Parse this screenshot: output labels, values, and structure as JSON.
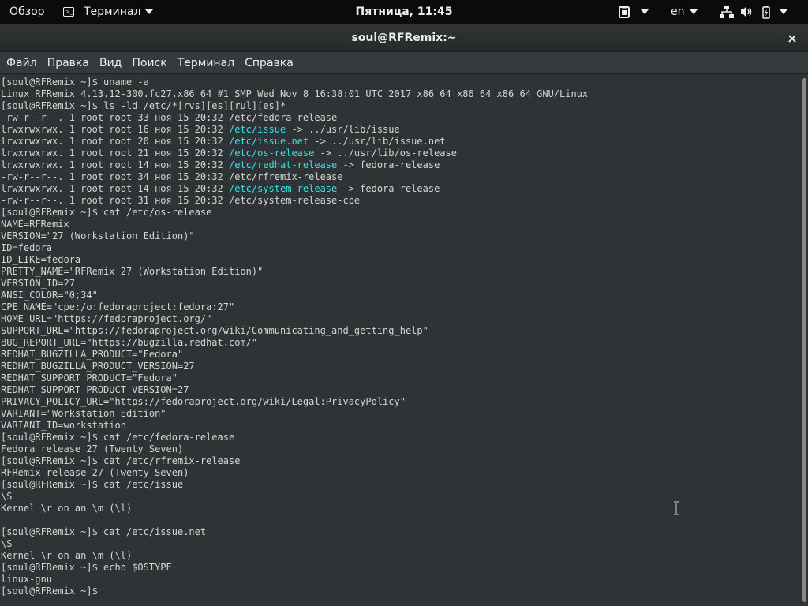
{
  "topbar": {
    "activities": "Обзор",
    "app_menu": "Терминал",
    "clock": "Пятница, 11:45",
    "language": "en",
    "icons": [
      "clipboard-icon",
      "network-icon",
      "volume-icon",
      "battery-icon"
    ]
  },
  "window": {
    "title": "soul@RFRemix:~",
    "close": "×"
  },
  "menubar": [
    "Файл",
    "Правка",
    "Вид",
    "Поиск",
    "Терминал",
    "Справка"
  ],
  "colors": {
    "terminal_bg": "#2e3436",
    "terminal_fg": "#d3d7cf",
    "symlink": "#34e2e2"
  },
  "terminal": {
    "lines": [
      [
        {
          "t": "[soul@RFRemix ~]$ uname -a"
        }
      ],
      [
        {
          "t": "Linux RFRemix 4.13.12-300.fc27.x86_64 #1 SMP Wed Nov 8 16:38:01 UTC 2017 x86_64 x86_64 x86_64 GNU/Linux"
        }
      ],
      [
        {
          "t": "[soul@RFRemix ~]$ ls -ld /etc/*[rvs][es][rul][es]*"
        }
      ],
      [
        {
          "t": "-rw-r--r--. 1 root root 33 ноя 15 20:32 /etc/fedora-release"
        }
      ],
      [
        {
          "t": "lrwxrwxrwx. 1 root root 16 ноя 15 20:32 "
        },
        {
          "t": "/etc/issue",
          "c": "cyan"
        },
        {
          "t": " -> ../usr/lib/issue"
        }
      ],
      [
        {
          "t": "lrwxrwxrwx. 1 root root 20 ноя 15 20:32 "
        },
        {
          "t": "/etc/issue.net",
          "c": "cyan"
        },
        {
          "t": " -> ../usr/lib/issue.net"
        }
      ],
      [
        {
          "t": "lrwxrwxrwx. 1 root root 21 ноя 15 20:32 "
        },
        {
          "t": "/etc/os-release",
          "c": "cyan"
        },
        {
          "t": " -> ../usr/lib/os-release"
        }
      ],
      [
        {
          "t": "lrwxrwxrwx. 1 root root 14 ноя 15 20:32 "
        },
        {
          "t": "/etc/redhat-release",
          "c": "cyan"
        },
        {
          "t": " -> fedora-release"
        }
      ],
      [
        {
          "t": "-rw-r--r--. 1 root root 34 ноя 15 20:32 /etc/rfremix-release"
        }
      ],
      [
        {
          "t": "lrwxrwxrwx. 1 root root 14 ноя 15 20:32 "
        },
        {
          "t": "/etc/system-release",
          "c": "cyan"
        },
        {
          "t": " -> fedora-release"
        }
      ],
      [
        {
          "t": "-rw-r--r--. 1 root root 31 ноя 15 20:32 /etc/system-release-cpe"
        }
      ],
      [
        {
          "t": "[soul@RFRemix ~]$ cat /etc/os-release"
        }
      ],
      [
        {
          "t": "NAME=RFRemix"
        }
      ],
      [
        {
          "t": "VERSION=\"27 (Workstation Edition)\""
        }
      ],
      [
        {
          "t": "ID=fedora"
        }
      ],
      [
        {
          "t": "ID_LIKE=fedora"
        }
      ],
      [
        {
          "t": "PRETTY_NAME=\"RFRemix 27 (Workstation Edition)\""
        }
      ],
      [
        {
          "t": "VERSION_ID=27"
        }
      ],
      [
        {
          "t": "ANSI_COLOR=\"0;34\""
        }
      ],
      [
        {
          "t": "CPE_NAME=\"cpe:/o:fedoraproject:fedora:27\""
        }
      ],
      [
        {
          "t": "HOME_URL=\"https://fedoraproject.org/\""
        }
      ],
      [
        {
          "t": "SUPPORT_URL=\"https://fedoraproject.org/wiki/Communicating_and_getting_help\""
        }
      ],
      [
        {
          "t": "BUG_REPORT_URL=\"https://bugzilla.redhat.com/\""
        }
      ],
      [
        {
          "t": "REDHAT_BUGZILLA_PRODUCT=\"Fedora\""
        }
      ],
      [
        {
          "t": "REDHAT_BUGZILLA_PRODUCT_VERSION=27"
        }
      ],
      [
        {
          "t": "REDHAT_SUPPORT_PRODUCT=\"Fedora\""
        }
      ],
      [
        {
          "t": "REDHAT_SUPPORT_PRODUCT_VERSION=27"
        }
      ],
      [
        {
          "t": "PRIVACY_POLICY_URL=\"https://fedoraproject.org/wiki/Legal:PrivacyPolicy\""
        }
      ],
      [
        {
          "t": "VARIANT=\"Workstation Edition\""
        }
      ],
      [
        {
          "t": "VARIANT_ID=workstation"
        }
      ],
      [
        {
          "t": "[soul@RFRemix ~]$ cat /etc/fedora-release"
        }
      ],
      [
        {
          "t": "Fedora release 27 (Twenty Seven)"
        }
      ],
      [
        {
          "t": "[soul@RFRemix ~]$ cat /etc/rfremix-release"
        }
      ],
      [
        {
          "t": "RFRemix release 27 (Twenty Seven)"
        }
      ],
      [
        {
          "t": "[soul@RFRemix ~]$ cat /etc/issue"
        }
      ],
      [
        {
          "t": "\\S"
        }
      ],
      [
        {
          "t": "Kernel \\r on an \\m (\\l)"
        }
      ],
      [],
      [
        {
          "t": "[soul@RFRemix ~]$ cat /etc/issue.net"
        }
      ],
      [
        {
          "t": "\\S"
        }
      ],
      [
        {
          "t": "Kernel \\r on an \\m (\\l)"
        }
      ],
      [
        {
          "t": "[soul@RFRemix ~]$ echo $OSTYPE"
        }
      ],
      [
        {
          "t": "linux-gnu"
        }
      ],
      [
        {
          "t": "[soul@RFRemix ~]$ "
        }
      ]
    ]
  }
}
